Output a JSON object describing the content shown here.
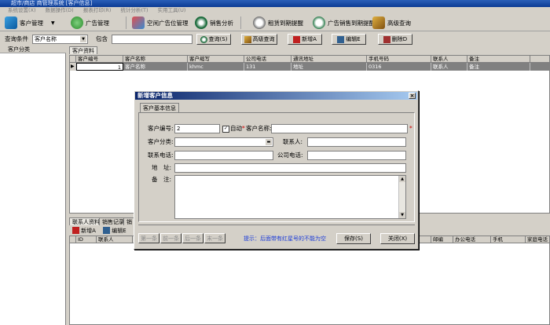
{
  "window": {
    "title": "超市/商店 商管理系统 [客户信息]"
  },
  "menu": [
    "系统设置(X)",
    "数据操作(D)",
    "报表打印(R)",
    "统计分析(T)",
    "实用工具(U)"
  ],
  "toolbar": {
    "customer_mgmt": "客户管理",
    "ad_mgmt": "广告管理",
    "vacant_ad": "空闲广告位管理",
    "sales": "销售分析",
    "lease_remind": "租赁到期提醒",
    "ad_sale_remind": "广告销售到期提醒",
    "advanced": "高级查询"
  },
  "query": {
    "condition_label": "查询条件",
    "field_value": "客户名称",
    "contains_label": "包含",
    "contains_value": "",
    "btn_query": "查询(S)",
    "btn_advanced": "高级查询",
    "btn_add": "新增A",
    "btn_edit": "编辑E",
    "btn_delete": "删除D"
  },
  "left": {
    "header": "客户分类"
  },
  "main": {
    "tab": "客户资料",
    "columns": [
      "客户编号",
      "客户名称",
      "客户缩写",
      "公司电话",
      "通讯地址",
      "手机号码",
      "联系人",
      "备注"
    ],
    "rows": [
      [
        "1",
        "客户名称",
        "khmc",
        "131",
        "地址",
        "0316",
        "联系人",
        "备注"
      ]
    ]
  },
  "bottom": {
    "tabs": [
      "联系人资料",
      "销售记录",
      "销"
    ],
    "btn_add": "新增A",
    "btn_edit": "编辑E",
    "columns_left": [
      "ID",
      "联系人",
      ""
    ],
    "columns_right": [
      "邮编",
      "办公电话",
      "手机",
      "家庭电话"
    ]
  },
  "dialog": {
    "title": "新增客户信息",
    "close": "×",
    "tab": "客户基本信息",
    "fields": {
      "code_label": "客户编号:",
      "code_value": "2",
      "auto_label": "自动",
      "req_star": "*",
      "name_label": "客户名称:",
      "category_label": "客户分类:",
      "contact_label": "联系人:",
      "phone_label": "联系电话:",
      "company_phone_label": "公司电话:",
      "address_label": "地　址:",
      "remark_label": "备　注:"
    },
    "nav": [
      "第一条",
      "前一条",
      "后一条",
      "末一条"
    ],
    "tip": "提示：后面带有红星号的不能为空",
    "btn_save": "保存(S)",
    "btn_close": "关闭(X)"
  },
  "colors": {
    "title_start": "#0a246a",
    "title_end": "#a6caf0",
    "tip": "#1a3ad8",
    "required": "#d00000"
  }
}
